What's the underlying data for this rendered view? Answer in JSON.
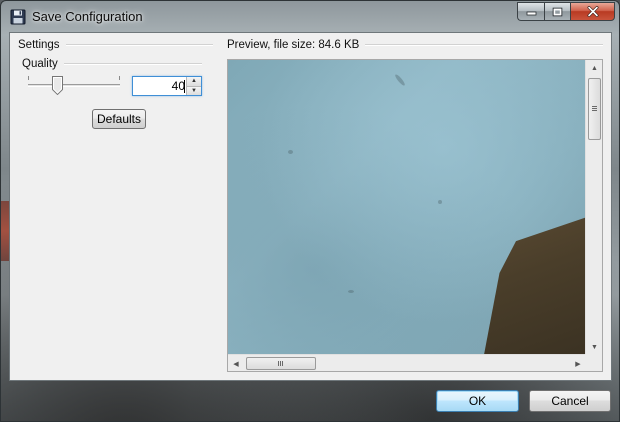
{
  "window": {
    "title": "Save Configuration",
    "icon": "floppy-disk-icon",
    "caption_buttons": [
      "minimize-icon",
      "maximize-icon",
      "close-icon"
    ]
  },
  "settings": {
    "group_label": "Settings",
    "quality": {
      "label": "Quality",
      "value": "40",
      "slider_fraction": 0.4
    },
    "defaults_label": "Defaults"
  },
  "preview": {
    "label": "Preview, file size: 84.6 KB",
    "vertical_scroll_fraction": 0.0,
    "horizontal_scroll_fraction": 0.0
  },
  "footer": {
    "ok_label": "OK",
    "cancel_label": "Cancel"
  },
  "colors": {
    "dialog_bg": "#f0f0f0",
    "ok_border": "#3c7fb1",
    "close_button": "#c9543c",
    "focus_border": "#3f8fd6"
  }
}
